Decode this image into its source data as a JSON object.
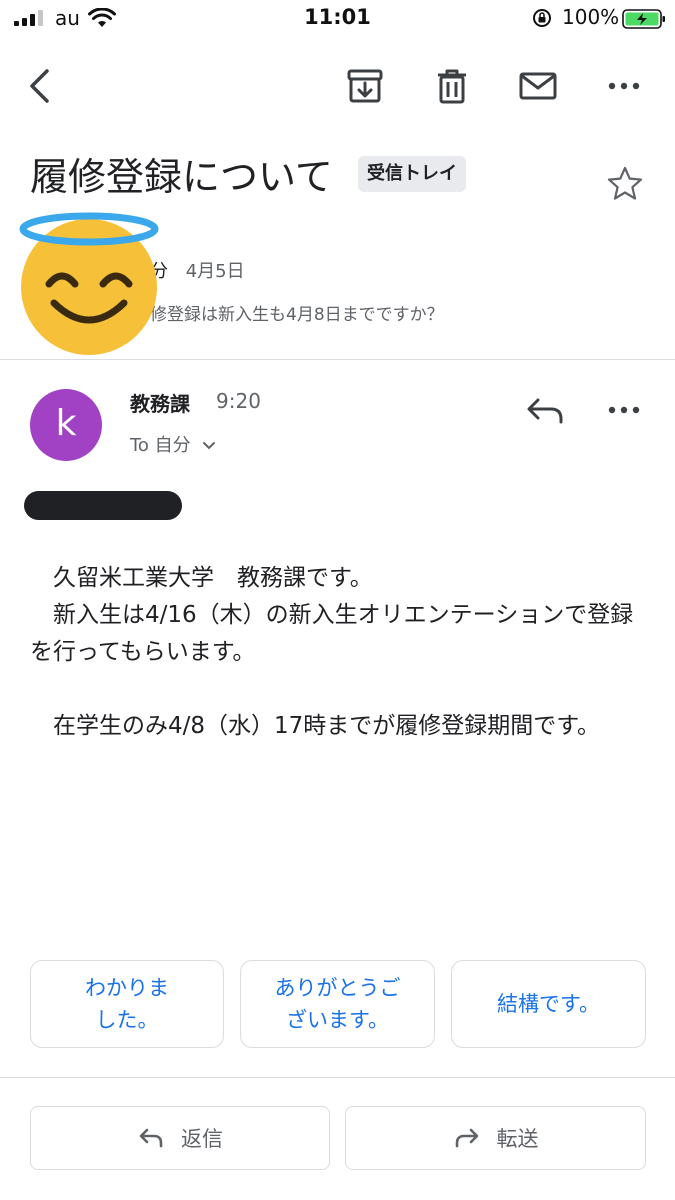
{
  "status_bar": {
    "carrier": "au",
    "time": "11:01",
    "battery": "100%",
    "icons": [
      "signal-icon",
      "wifi-icon",
      "orientation-lock-icon",
      "battery-icon"
    ]
  },
  "toolbar": {
    "icons": [
      "back-arrow-icon",
      "archive-icon",
      "trash-icon",
      "mail-icon",
      "more-icon"
    ]
  },
  "subject": {
    "title": "履修登録について",
    "label": "受信トレイ"
  },
  "collapsed_message": {
    "sender_partial": "分",
    "date": "4月5日",
    "snippet": "修登録は新入生も4月8日までですか？"
  },
  "message": {
    "avatar_letter": "k",
    "avatar_color": "#a142c4",
    "sender": "教務課",
    "time": "9:20",
    "recipient": "To 自分",
    "body": [
      "　久留米工業大学　教務課です。\n　新入生は4/16（木）の新入生オリエンテーションで登録を行ってもらいます。",
      "　在学生のみ4/8（水）17時までが履修登録期間です。"
    ]
  },
  "smart_replies": [
    "わかりま\nした。",
    "ありがとうご\nざいます。",
    "結構です。"
  ],
  "actions": {
    "reply": "返信",
    "forward": "転送"
  },
  "colors": {
    "accent": "#1a73e8",
    "label_bg": "#e8eaed",
    "divider": "#dadce0"
  }
}
